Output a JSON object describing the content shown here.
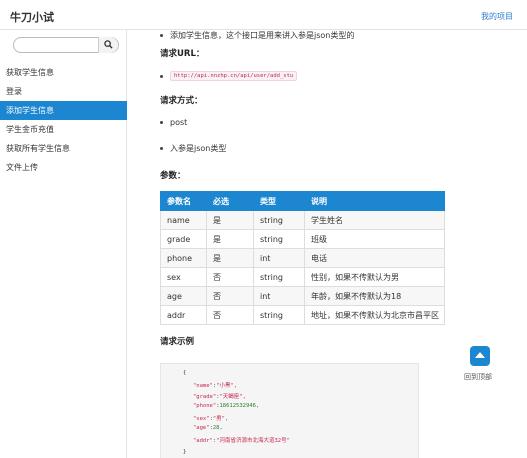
{
  "header": {
    "title": "牛刀小试",
    "link": "我的项目"
  },
  "sidebar": {
    "search": {
      "value": "",
      "placeholder": ""
    },
    "items": [
      {
        "label": "获取学生信息",
        "active": false
      },
      {
        "label": "登录",
        "active": false
      },
      {
        "label": "添加学生信息",
        "active": true
      },
      {
        "label": "学生金币充值",
        "active": false
      },
      {
        "label": "获取所有学生信息",
        "active": false
      },
      {
        "label": "文件上传",
        "active": false
      }
    ]
  },
  "main": {
    "intro": "添加学生信息，这个接口是用来讲入参是json类型的",
    "url_heading": "请求URL：",
    "url": "http://api.nnzhp.cn/api/user/add_stu",
    "method_heading": "请求方式：",
    "method_items": [
      "post",
      "入参是json类型"
    ],
    "params_heading": "参数：",
    "params_table": {
      "headers": [
        "参数名",
        "必选",
        "类型",
        "说明"
      ],
      "rows": [
        [
          "name",
          "是",
          "string",
          "学生姓名"
        ],
        [
          "grade",
          "是",
          "string",
          "班级"
        ],
        [
          "phone",
          "是",
          "int",
          "电话"
        ],
        [
          "sex",
          "否",
          "string",
          "性别，如果不传默认为男"
        ],
        [
          "age",
          "否",
          "int",
          "年龄，如果不传默认为18"
        ],
        [
          "addr",
          "否",
          "string",
          "地址，如果不传默认为北京市昌平区"
        ]
      ]
    },
    "example_heading": "请求示例",
    "example_lines": [
      {
        "key": "",
        "value": "{"
      },
      {
        "key": "\"name\"",
        "value": "\"小黑\","
      },
      {
        "key": "\"grade\"",
        "value": "\"天蝎座\","
      },
      {
        "key": "\"phone\"",
        "value": "18612532946,"
      },
      {
        "key": "\"sex\"",
        "value": "\"男\","
      },
      {
        "key": "\"age\"",
        "value": "28,"
      },
      {
        "key": "\"addr\"",
        "value": "\"河南省济源市北海大道32号\""
      },
      {
        "key": "",
        "value": "}"
      }
    ]
  },
  "back_to_top": {
    "label": "回到顶部"
  },
  "colors": {
    "accent": "#1c86d1",
    "code_key": "#c7254e"
  }
}
